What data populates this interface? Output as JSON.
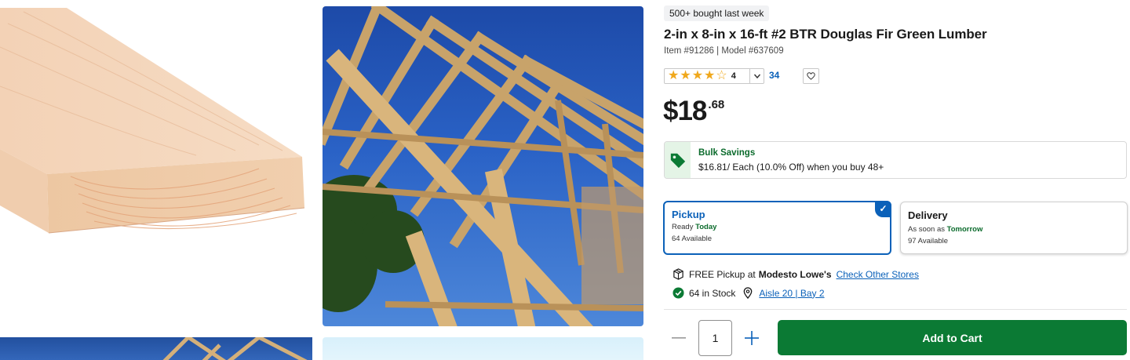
{
  "product": {
    "badge": "500+ bought last week",
    "title": "2-in x 8-in x 16-ft #2 BTR Douglas Fir Green Lumber",
    "item_model": "Item #91286 | Model #637609",
    "rating": {
      "value": "4",
      "stars_filled": 4,
      "stars_total": 5,
      "review_count": "34"
    },
    "price": {
      "main": "$18",
      "cents": ".68"
    }
  },
  "bulk_savings": {
    "title": "Bulk Savings",
    "text": "$16.81/ Each (10.0% Off) when you buy 48+",
    "icon": "tag-icon"
  },
  "fulfillment": {
    "pickup": {
      "title": "Pickup",
      "ready_prefix": "Ready",
      "ready_when": "Today",
      "availability": "64 Available",
      "selected": true
    },
    "delivery": {
      "title": "Delivery",
      "ready_prefix": "As soon as",
      "ready_when": "Tomorrow",
      "availability": "97 Available",
      "selected": false
    }
  },
  "store": {
    "pickup_prefix": "FREE Pickup at",
    "store_name": "Modesto Lowe's",
    "check_other": "Check Other Stores",
    "stock": "64 in Stock",
    "location": "Aisle 20 | Bay 2"
  },
  "cart": {
    "quantity": "1",
    "add_label": "Add to Cart"
  },
  "colors": {
    "brand_blue": "#0b61b9",
    "cart_green": "#0b7a34",
    "savings_green": "#0b6b2c",
    "star": "#f0a81c"
  }
}
